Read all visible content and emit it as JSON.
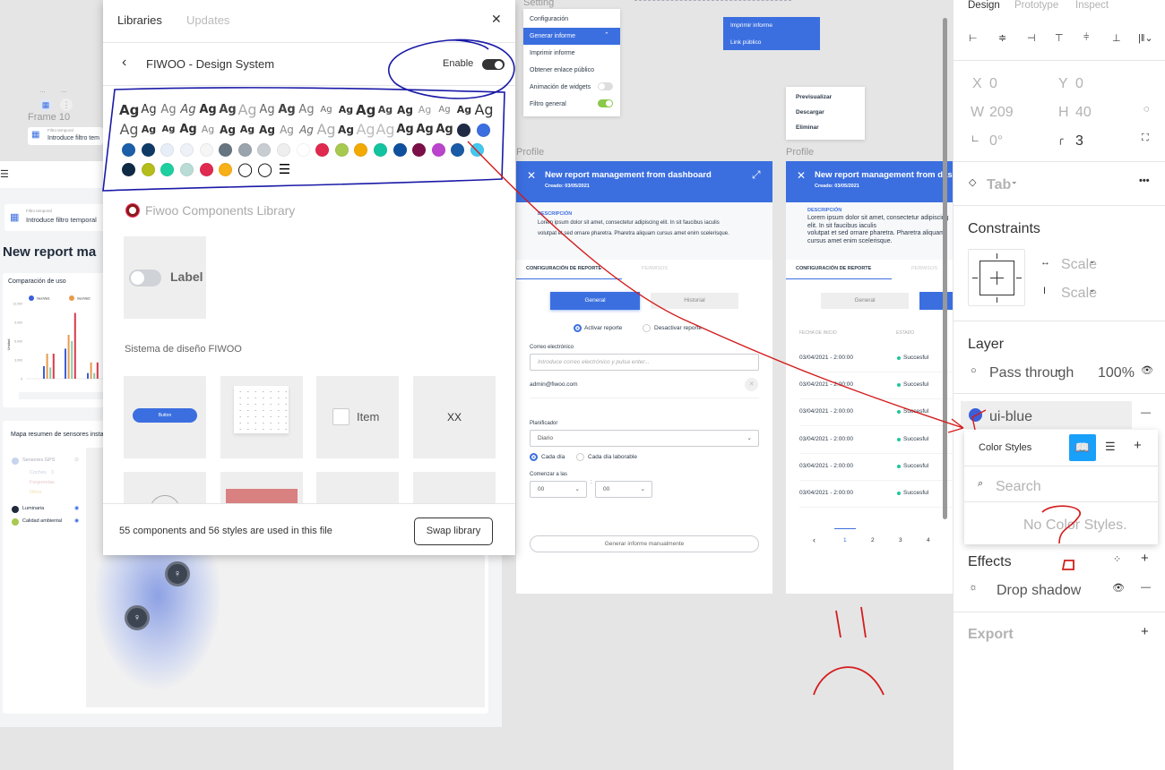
{
  "canvas": {
    "frame10": {
      "label": "Frame 10",
      "dots": "...",
      "filter_label": "Filtro temporal",
      "filter_value": "Introduce filtro tem"
    },
    "setting_label": "Setting",
    "setting_menu": {
      "items": [
        "Configuración",
        "Generar informe",
        "Imprimir informe",
        "Obtener enlace público",
        "Animación de widgets",
        "Filtro general"
      ],
      "toggles": {
        "animacion": false,
        "filtro": true
      }
    },
    "blue_menu": [
      "Imprimir informe",
      "Link público"
    ],
    "context_menu": [
      "Previsualizar",
      "Descargar",
      "Eliminar"
    ],
    "dashboard": {
      "filter_label": "Filtro temporal",
      "filter_value": "Introduce filtro temporal",
      "title": "New report ma",
      "chart_title": "Comparación de uso",
      "map_title": "Mapa resumen de sensores insta",
      "map_legend": {
        "gps": "Sensores GPS",
        "sub": [
          "Coches",
          "Furgonetas",
          "Otros"
        ],
        "coches_count": "3",
        "luminaria": "Luminaria",
        "calidad": "Calidad ambiental"
      }
    },
    "profiles": [
      {
        "label": "Profile",
        "title": "New report management from dashboard",
        "created": "Creado: 03/05/2021",
        "desc_label": "DESCRIPCIÓN",
        "desc_1": "Lorem ipsum dolor sit amet, consectetur adipiscing elit. In sit faucibus iaculis",
        "desc_2": "volutpat et sed ornare pharetra. Pharetra aliquam cursus amet enim scelerisque.",
        "tab_active": "CONFIGURACIÓN DE REPORTE",
        "tab_inactive": "PERMISOS",
        "btn_general": "General",
        "btn_historial": "Historial",
        "radio_on": "Activar reporte",
        "radio_off": "Desactivar reporte",
        "email_label": "Correo electrónico",
        "email_placeholder": "Introduce correo electrónico y pulsa enter...",
        "email_value": "admin@fiwoo.com",
        "planner_label": "Planificador",
        "planner_value": "Diario",
        "every_day": "Cada día",
        "every_workday": "Cada día laborable",
        "start_label": "Comenzar a las",
        "hour": "00",
        "minute": "00",
        "colon": ":",
        "generate": "Generar informe manualmente"
      },
      {
        "label": "Profile",
        "title": "New report management from dashboard",
        "created": "Creado: 03/05/2021",
        "desc_label": "DESCRIPCIÓN",
        "desc_1": "Lorem ipsum dolor sit amet, consectetur adipiscing elit. In sit faucibus iaculis",
        "desc_2": "volutpat et sed ornare pharetra. Pharetra aliquam cursus amet enim scelerisque.",
        "tab_active": "CONFIGURACIÓN DE REPORTE",
        "tab_inactive": "PERMISOS",
        "btn_general": "General",
        "col_date": "FECHA DE INICIO",
        "col_status": "ESTADO",
        "rows": [
          {
            "date": "03/04/2021 - 2:00:00",
            "status": "Succesful"
          },
          {
            "date": "03/04/2021 - 2:00:00",
            "status": "Succesful"
          },
          {
            "date": "03/04/2021 - 2:00:00",
            "status": "Succesful"
          },
          {
            "date": "03/04/2021 - 2:00:00",
            "status": "Succesful"
          },
          {
            "date": "03/04/2021 - 2:00:00",
            "status": "Succesful"
          },
          {
            "date": "03/04/2021 - 2:00:00",
            "status": "Succesful"
          }
        ],
        "pagination": {
          "prev": "‹",
          "pages": [
            "1",
            "2",
            "3",
            "4"
          ],
          "current": "1"
        }
      }
    ]
  },
  "libraries": {
    "tabs": [
      "Libraries",
      "Updates"
    ],
    "library_name": "FIWOO - Design System",
    "enable_label": "Enable",
    "enabled": true,
    "text_styles": [
      "Ag",
      "Ag",
      "Ag",
      "Ag",
      "Ag",
      "Ag",
      "Ag",
      "Ag",
      "Ag",
      "Ag",
      "Ag",
      "Ag",
      "Ag",
      "Ag",
      "Ag",
      "Ag",
      "Ag",
      "Ag",
      "Ag",
      "Ag",
      "Ag",
      "Ag",
      "Ag",
      "Ag",
      "Ag",
      "Ag",
      "Ag",
      "Ag",
      "Ag",
      "Ag",
      "Ag",
      "Ag",
      "Ag",
      "Ag",
      "Ag",
      "Ag"
    ],
    "color_styles": [
      "#1f2a44",
      "#3b6fe0",
      "#1a5fa8",
      "#0f3a66",
      "#e8eef8",
      "#eef2f8",
      "#f6f6f6",
      "#667580",
      "#9aa4ad",
      "#c8cdd2",
      "#eeeeee",
      "#ffffff",
      "#e0294f",
      "#a8c94f",
      "#f2a900",
      "#14c4a0",
      "#0e4f9e",
      "#7a1047",
      "#bb44cc",
      "#1a5ba6",
      "#43c9f0",
      "#0f2a44",
      "#b5bd1a",
      "#1ecf9f",
      "#b9ddd6",
      "#e0294f",
      "#f7b016"
    ],
    "components_library": "Fiwoo Components Library",
    "toggle_label": "Label",
    "section": "Sistema de diseño FIWOO",
    "tile_button": "Button",
    "tile_item": "Item",
    "tile_xx": "XX",
    "footer_text": "55 components and 56 styles are used in this file",
    "swap_button": "Swap library"
  },
  "right_panel": {
    "tabs": [
      "Design",
      "Prototype",
      "Inspect"
    ],
    "x_label": "X",
    "x": "0",
    "y_label": "Y",
    "y": "0",
    "w_label": "W",
    "w": "209",
    "h_label": "H",
    "h": "40",
    "rotation": "0°",
    "radius": "3",
    "component": "Tab",
    "constraints_title": "Constraints",
    "h_constraint": "Scale",
    "v_constraint": "Scale",
    "layer_title": "Layer",
    "blend": "Pass through",
    "opacity": "100%",
    "fill_style": "ui-blue",
    "fill_color": "#3b5fd9",
    "color_styles_popup": {
      "title": "Color Styles",
      "search_placeholder": "Search",
      "empty": "No Color Styles.",
      "active_view_color": "#18a0fb"
    },
    "effects_title": "Effects",
    "effect": "Drop shadow",
    "export_title": "Export"
  },
  "chart_data": {
    "type": "bar",
    "title": "Comparación de uso",
    "ylabel": "Unidad",
    "ylim": [
      0,
      12000
    ],
    "yticks": [
      "0",
      "3.000",
      "6.000",
      "9.000",
      "12.000"
    ],
    "legend": [
      "SecVal1",
      "SecVal2"
    ],
    "series": [
      {
        "name": "SecVal1",
        "color": "#3b5fd9",
        "values": [
          2000,
          4800,
          900
        ]
      },
      {
        "name": "SecVal2",
        "color": "#e89a4d",
        "values": [
          4000,
          7000,
          2600
        ]
      },
      {
        "color": "#8cc9a8",
        "values": [
          1800,
          6000,
          900
        ]
      },
      {
        "color": "#d93a4a",
        "values": [
          4000,
          10500,
          2600
        ]
      }
    ]
  }
}
